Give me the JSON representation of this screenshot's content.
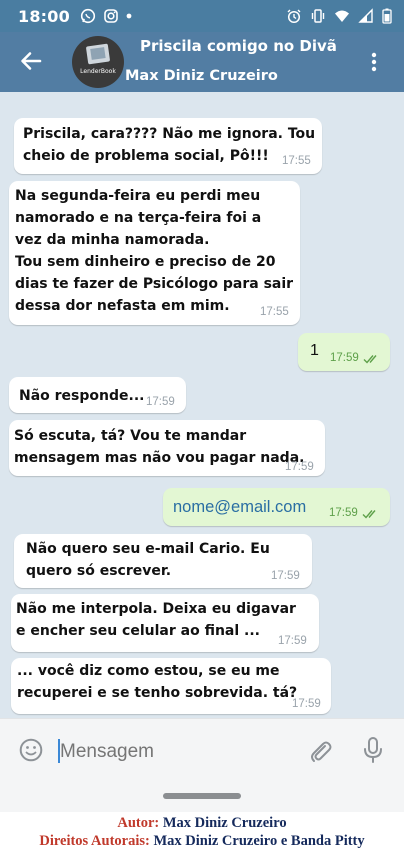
{
  "status_bar": {
    "time": "18:00",
    "left_icons": [
      "whatsapp-icon",
      "instagram-icon",
      "dot-icon"
    ],
    "right_icons": [
      "alarm-icon",
      "vibrate-icon",
      "wifi-icon",
      "signal-icon",
      "battery-icon"
    ]
  },
  "header": {
    "title": "Priscila comigo no Divã",
    "subtitle": "Max Diniz Cruzeiro",
    "avatar_label": "LenderBook"
  },
  "messages": [
    {
      "direction": "in",
      "text": "Priscila, cara???? Não me ignora. Tou\ncheio de problema social, Pô!!!",
      "time": "17:55"
    },
    {
      "direction": "in",
      "text": "Na segunda-feira eu perdi meu\nnamorado e na terça-feira foi a\nvez da minha namorada.\nTou sem dinheiro e preciso de 20\ndias te fazer de Psicólogo para sair\ndessa dor nefasta em mim.",
      "time": "17:55"
    },
    {
      "direction": "out",
      "text": "1",
      "time": "17:59",
      "read": true
    },
    {
      "direction": "in",
      "text": "Não responde...",
      "time": "17:59"
    },
    {
      "direction": "in",
      "text": "Só escuta, tá? Vou te mandar\nmensagem mas não vou pagar nada.",
      "time": "17:59"
    },
    {
      "direction": "out",
      "text": "nome@email.com",
      "time": "17:59",
      "read": true
    },
    {
      "direction": "in",
      "text": "Não quero seu e-mail Cario. Eu\nquero só escrever.",
      "time": "17:59"
    },
    {
      "direction": "in",
      "text": "Não me interpola. Deixa eu digavar\ne encher seu celular ao final ...",
      "time": "17:59"
    },
    {
      "direction": "in",
      "text": "... você diz como estou, se eu me\nrecuperei e se tenho sobrevida. tá?",
      "time": "17:59"
    }
  ],
  "input": {
    "placeholder": "Mensagem"
  },
  "credits": {
    "author_label": "Autor:",
    "author_value": "Max Diniz Cruzeiro",
    "rights_label": "Direitos Autorais:",
    "rights_value": "Max Diniz Cruzeiro e Banda Pitty"
  },
  "colors": {
    "header": "#527da3",
    "chat_background": "#dce6ee",
    "outgoing_bubble": "#e3f7d3",
    "incoming_bubble": "#ffffff",
    "read_ticks": "#5ea04a"
  }
}
